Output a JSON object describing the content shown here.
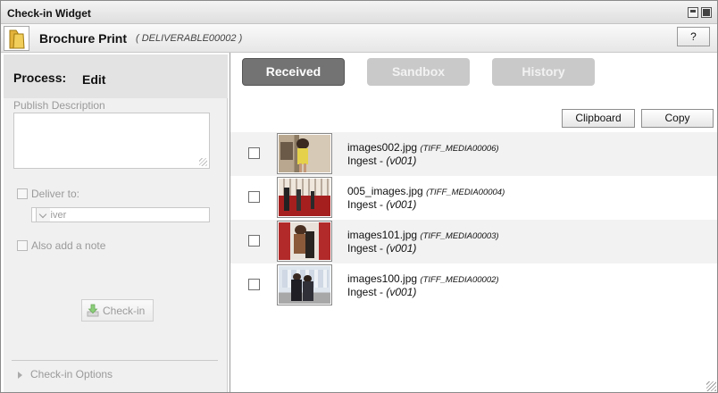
{
  "window": {
    "title": "Check-in Widget"
  },
  "header": {
    "doc_title": "Brochure Print",
    "doc_id": "( DELIVERABLE00002 )",
    "help_label": "?"
  },
  "left": {
    "process_label": "Process:",
    "process_value": "Edit",
    "publish_description_label": "Publish Description",
    "publish_description_value": "",
    "deliver_to_label": "Deliver to:",
    "deliver_select_value": "Deliver",
    "add_note_label": "Also add a note",
    "checkin_label": "Check-in",
    "options_label": "Check-in Options"
  },
  "tabs": [
    {
      "label": "Received",
      "active": true
    },
    {
      "label": "Sandbox",
      "active": false
    },
    {
      "label": "History",
      "active": false
    }
  ],
  "actions": {
    "clipboard": "Clipboard",
    "copy": "Copy"
  },
  "items": [
    {
      "name": "images002.jpg",
      "id": "(TIFF_MEDIA00006)",
      "ingest": "Ingest - ",
      "version": "(v001)"
    },
    {
      "name": "005_images.jpg",
      "id": "(TIFF_MEDIA00004)",
      "ingest": "Ingest - ",
      "version": "(v001)"
    },
    {
      "name": "images101.jpg",
      "id": "(TIFF_MEDIA00003)",
      "ingest": "Ingest - ",
      "version": "(v001)"
    },
    {
      "name": "images100.jpg",
      "id": "(TIFF_MEDIA00002)",
      "ingest": "Ingest - ",
      "version": "(v001)"
    }
  ],
  "colors": {
    "active_tab": "#737373",
    "inactive_tab": "#c9c9c9",
    "panel_bg": "#f0f0f0",
    "row_alt": "#f2f2f2"
  }
}
